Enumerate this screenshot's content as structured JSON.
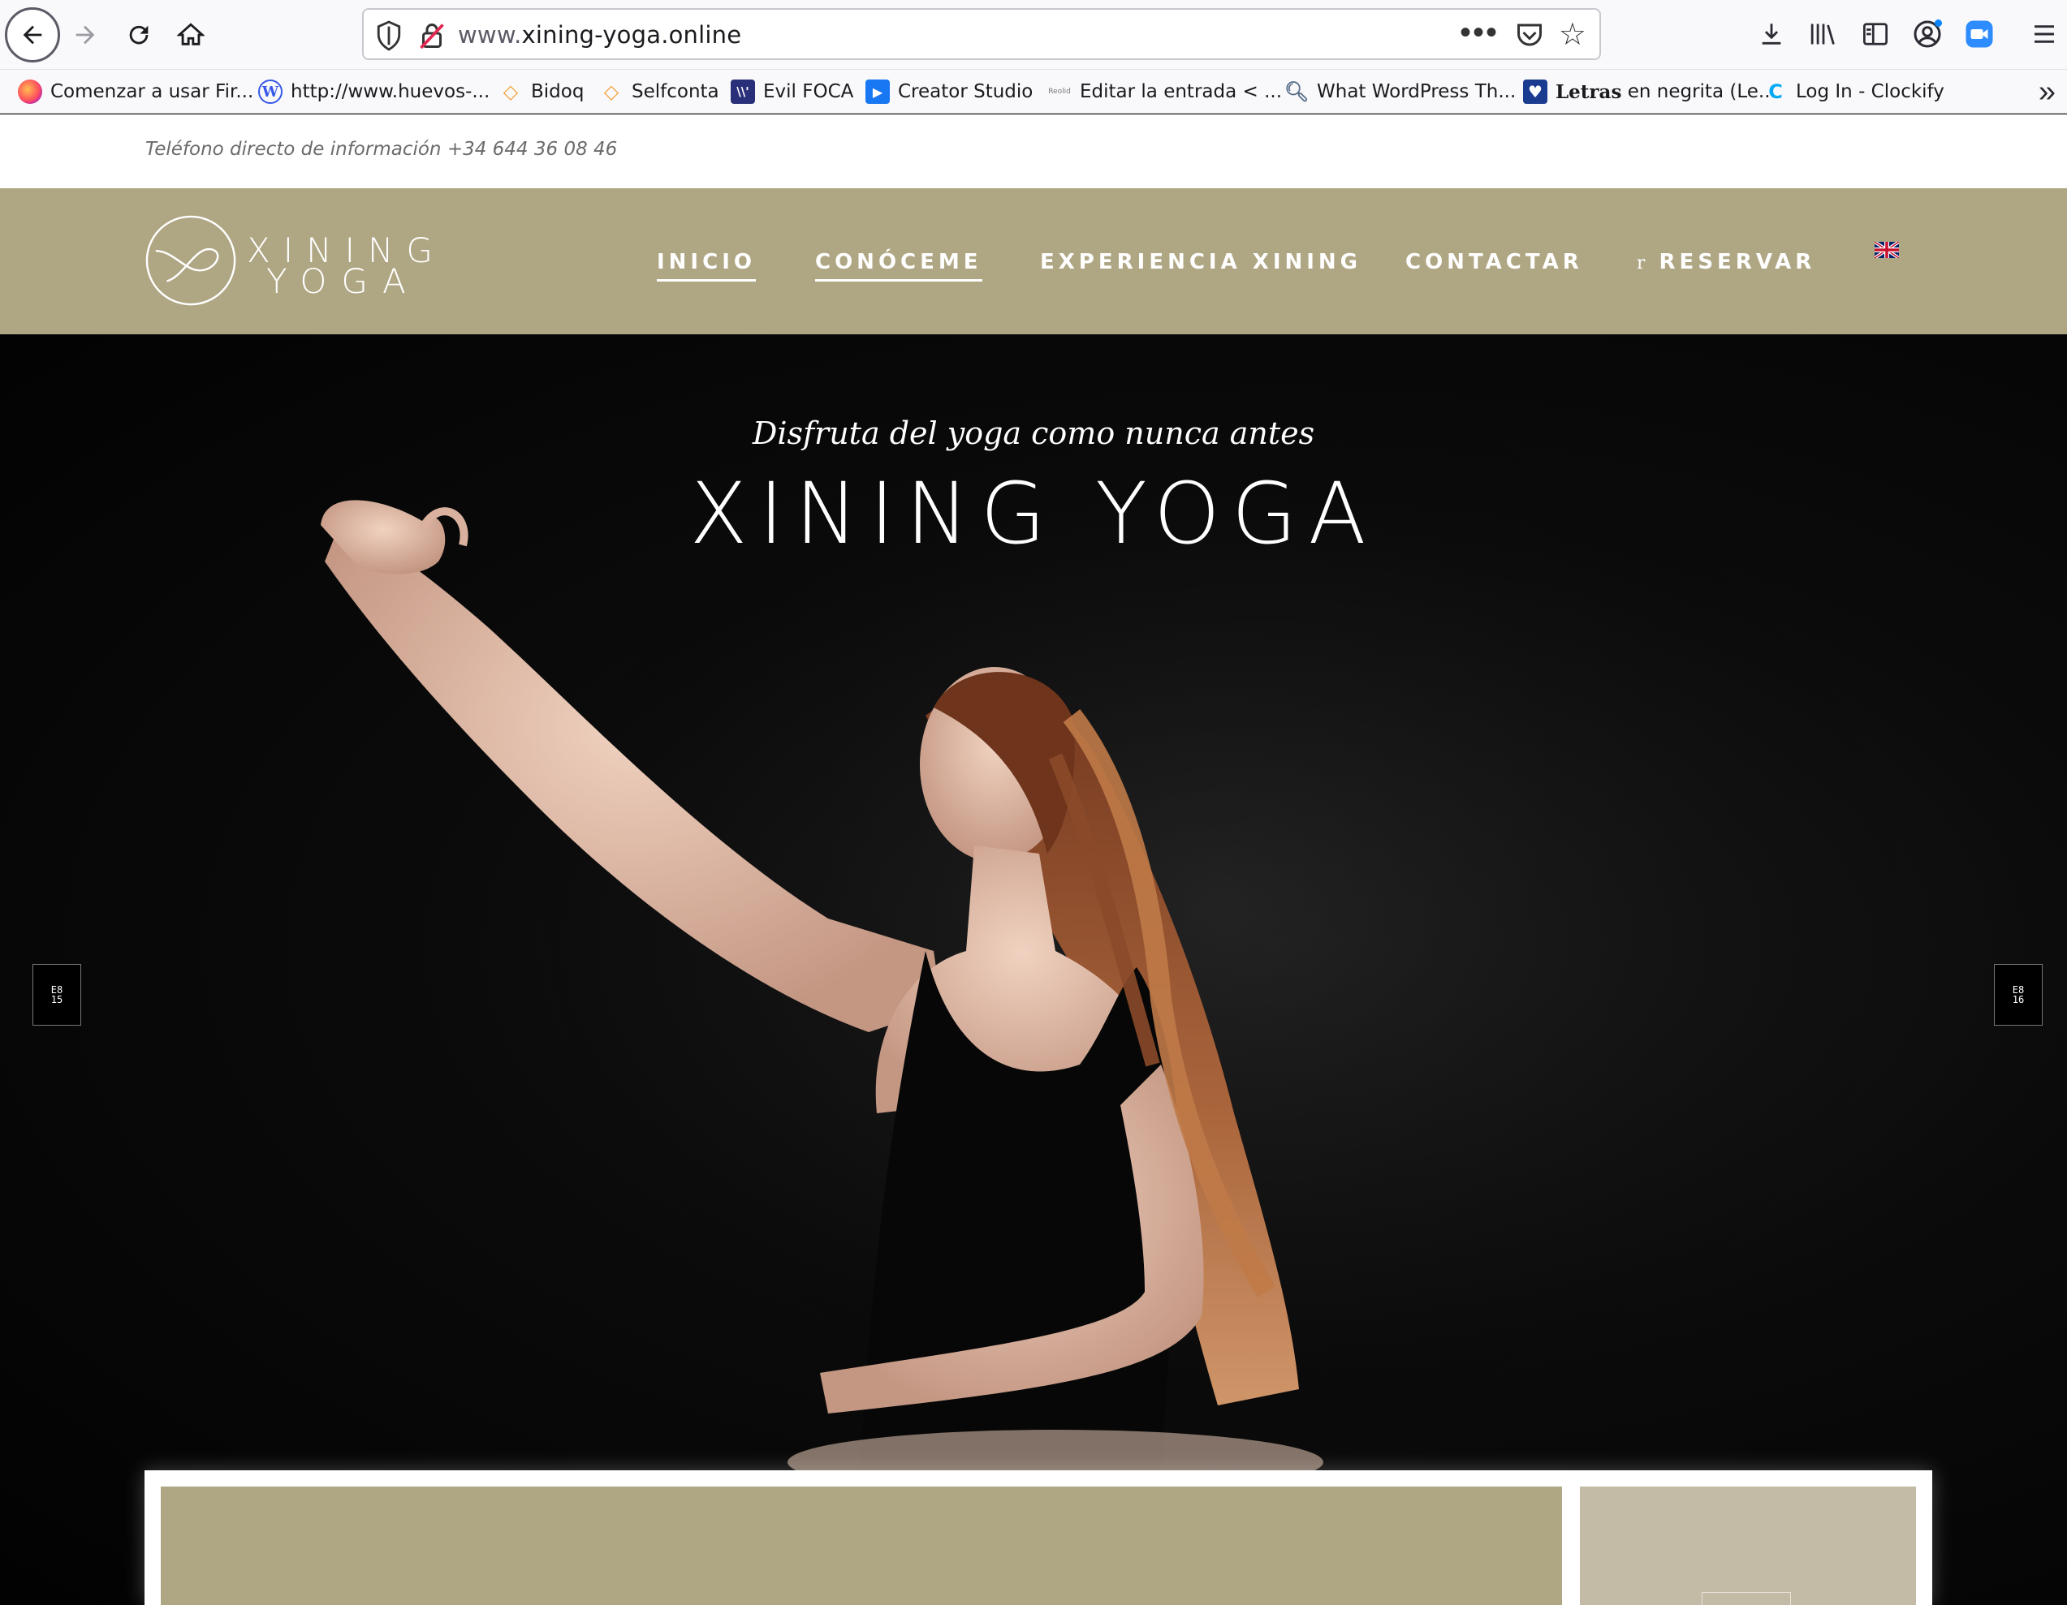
{
  "browser": {
    "url_prefix": "www.",
    "url_domain": "xining-yoga.online",
    "bookmarks": [
      {
        "label": "Comenzar a usar Fir...",
        "icon": "firefox-icon"
      },
      {
        "label": "http://www.huevos-...",
        "icon": "wordpress-icon"
      },
      {
        "label": "Bidoq",
        "icon": "bidoq-icon"
      },
      {
        "label": "Selfconta",
        "icon": "selfconta-icon"
      },
      {
        "label": "Evil FOCA",
        "icon": "evil-foca-icon"
      },
      {
        "label": "Creator Studio",
        "icon": "creator-studio-icon"
      },
      {
        "label": "Editar la entrada < ...",
        "icon": "editar-entrada-icon"
      },
      {
        "label": "What WordPress Th...",
        "icon": "magnifier-icon"
      },
      {
        "label_bold": "Letras",
        "label": " en negrita (Le...",
        "icon": "heart-icon"
      },
      {
        "label": "Log In - Clockify",
        "icon": "clockify-icon"
      }
    ]
  },
  "site": {
    "phone_text": "Teléfono directo de información +34 644 36 08 46",
    "logo": {
      "line1": "XINING",
      "line2": "YOGA"
    },
    "menu": [
      {
        "label": "INICIO"
      },
      {
        "label": "CONÓCEME"
      },
      {
        "label": "EXPERIENCIA XINING"
      },
      {
        "label": "CONTACTAR"
      },
      {
        "label": "RESERVAR",
        "prefix": "r"
      }
    ],
    "hero": {
      "subtitle": "Disfruta del yoga como nunca antes",
      "title": "XINING YOGA"
    },
    "slider": {
      "prev_label": "E8\n15",
      "next_label": "E8\n16"
    }
  },
  "colors": {
    "header_bg": "#afa683",
    "card_right_bg": "#c3bba5",
    "hero_bg": "#000000"
  }
}
